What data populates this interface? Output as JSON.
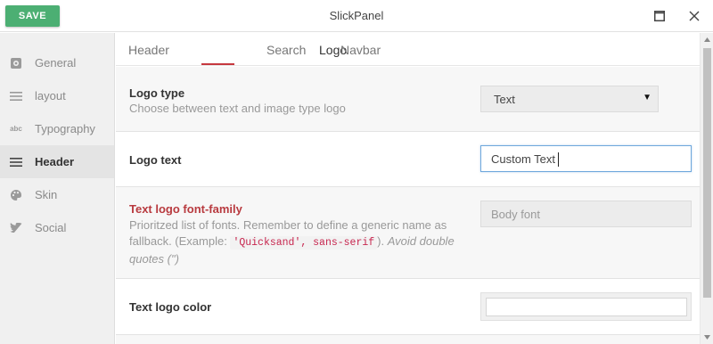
{
  "titlebar": {
    "save_label": "SAVE",
    "title": "SlickPanel"
  },
  "sidebar": {
    "items": [
      {
        "label": "General",
        "icon": "gear-icon"
      },
      {
        "label": "layout",
        "icon": "lines-icon"
      },
      {
        "label": "Typography",
        "icon": "abc-icon",
        "icon_text": "abc"
      },
      {
        "label": "Header",
        "icon": "lines-icon",
        "active": true
      },
      {
        "label": "Skin",
        "icon": "palette-icon"
      },
      {
        "label": "Social",
        "icon": "twitter-icon"
      }
    ]
  },
  "tabs": [
    {
      "label": "Header"
    },
    {
      "label": "Logo",
      "active": true
    },
    {
      "label": "Search"
    },
    {
      "label": "Navbar"
    }
  ],
  "settings": {
    "logo_type": {
      "label": "Logo type",
      "description": "Choose between text and image type logo",
      "value": "Text"
    },
    "logo_text": {
      "label": "Logo text",
      "value": "Custom Text"
    },
    "font_family": {
      "label": "Text logo font-family",
      "desc_part1": "Prioritzed list of fonts. Remember to define a generic name as fallback. (Example: ",
      "desc_code": "'Quicksand', sans-serif",
      "desc_part2": "). ",
      "desc_italic": "Avoid double quotes (\")",
      "placeholder": "Body font"
    },
    "logo_color": {
      "label": "Text logo color",
      "value": ""
    }
  },
  "colors": {
    "save": "#4caf73",
    "accent": "#c6393f",
    "focus": "#6fa8dc"
  }
}
